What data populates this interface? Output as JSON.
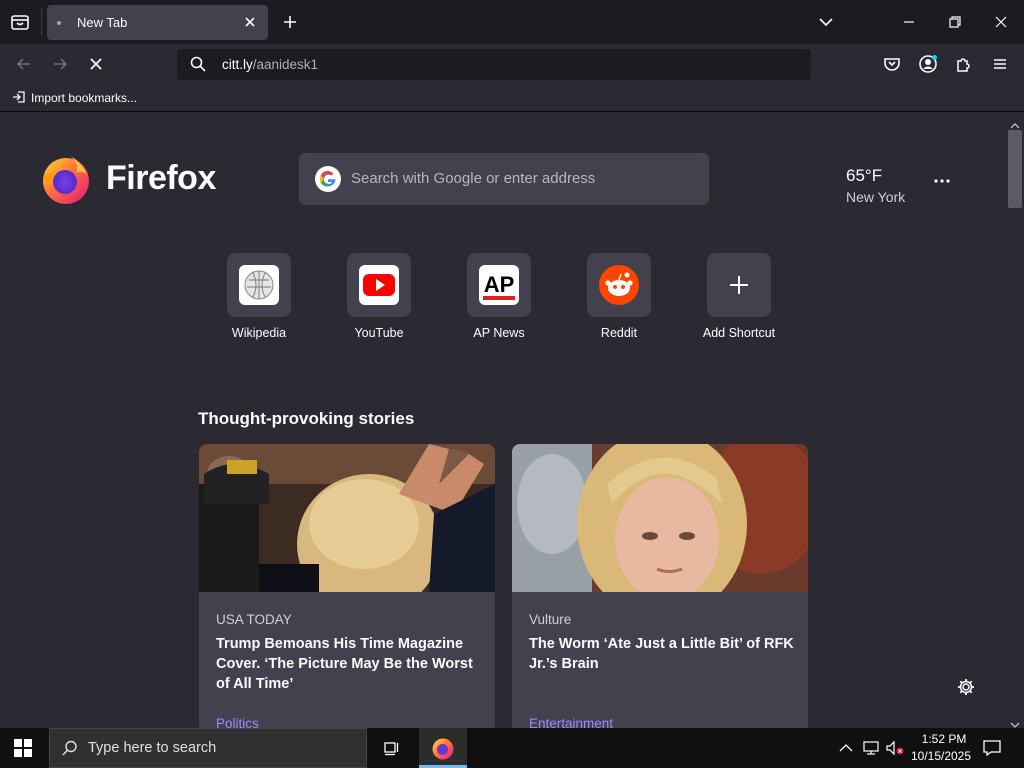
{
  "browser": {
    "tab": {
      "title": "New Tab"
    },
    "address": {
      "host": "citt.ly",
      "path": "/aanidesk1"
    },
    "bookmarks": [
      {
        "label": "Import bookmarks..."
      }
    ]
  },
  "newtab": {
    "brand": "Firefox",
    "search_placeholder": "Search with Google or enter address",
    "weather": {
      "temp": "65°F",
      "city": "New York"
    },
    "shortcuts": [
      {
        "label": "Wikipedia"
      },
      {
        "label": "YouTube"
      },
      {
        "label": "AP News"
      },
      {
        "label": "Reddit"
      },
      {
        "label": "Add Shortcut"
      }
    ],
    "stories_heading": "Thought-provoking stories",
    "stories": [
      {
        "source": "USA TODAY",
        "title": "Trump Bemoans His Time Magazine Cover. ‘The Picture May Be the Worst of All Time’",
        "category": "Politics"
      },
      {
        "source": "Vulture",
        "title": "The Worm ‘Ate Just a Little Bit’ of RFK Jr.’s Brain",
        "category": "Entertainment"
      }
    ]
  },
  "taskbar": {
    "search_placeholder": "Type here to search",
    "time": "1:52 PM",
    "date": "10/15/2025"
  },
  "colors": {
    "accent_purple": "#a684ff",
    "tab_bg": "#42414d",
    "chrome_dark": "#1c1b22"
  }
}
